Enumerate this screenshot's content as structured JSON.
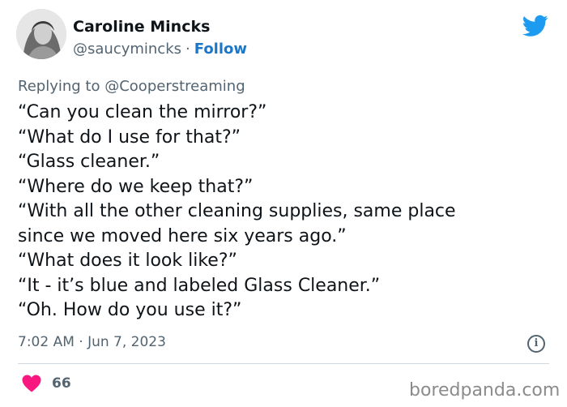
{
  "author": {
    "name": "Caroline Mincks",
    "handle": "@saucymincks",
    "separator": "·",
    "follow_label": "Follow"
  },
  "reply": {
    "prefix": "Replying to",
    "mention": "@Cooperstreaming"
  },
  "tweet_lines": [
    "“Can you clean the mirror?”",
    "“What do I use for that?”",
    "“Glass cleaner.”",
    "“Where do we keep that?”",
    "“With all the other cleaning supplies, same place",
    "since we moved here six years ago.”",
    "“What does it look like?”",
    "“It - it’s blue and labeled Glass Cleaner.”",
    "“Oh. How do you use it?”"
  ],
  "timestamp": "7:02 AM · Jun 7, 2023",
  "likes_count": "66",
  "watermark": "boredpanda.com",
  "icons": {
    "brand": "twitter-bird-icon",
    "like": "heart-icon",
    "info": "info-icon"
  },
  "colors": {
    "follow": "#1d77c8",
    "twitter_blue": "#1d9bf0",
    "heart": "#f91880",
    "secondary_text": "#536471"
  }
}
